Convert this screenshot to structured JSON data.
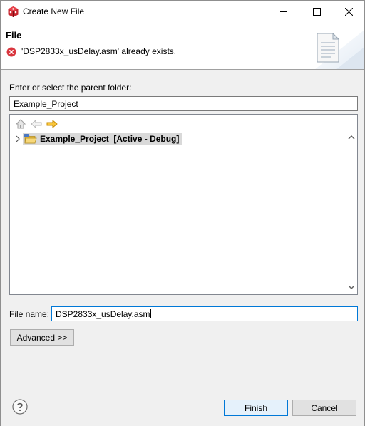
{
  "window": {
    "title": "Create New File"
  },
  "banner": {
    "title": "File",
    "error_message": "'DSP2833x_usDelay.asm' already exists."
  },
  "folder": {
    "label": "Enter or select the parent folder:",
    "value": "Example_Project"
  },
  "tree": {
    "items": [
      {
        "label": "Example_Project  [Active - Debug]",
        "selected": true,
        "expanded": false
      }
    ],
    "toolbar": [
      "home-icon",
      "back-arrow-icon",
      "forward-arrow-icon"
    ]
  },
  "file_name": {
    "label": "File name:",
    "value": "DSP2833x_usDelay.asm"
  },
  "buttons": {
    "advanced": "Advanced >>",
    "finish": "Finish",
    "cancel": "Cancel"
  },
  "colors": {
    "accent": "#0078d7",
    "error": "#d9363e",
    "folder": "#f0c040",
    "forward_arrow": "#f4b400"
  }
}
